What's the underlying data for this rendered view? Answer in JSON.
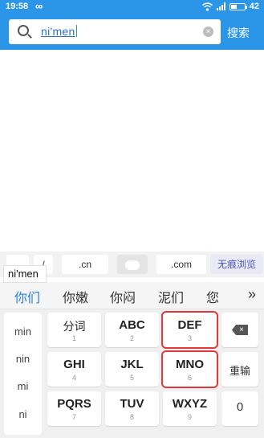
{
  "status_bar": {
    "time": "19:58",
    "battery": "42",
    "battery_level": 0.42
  },
  "search": {
    "query": "ni'men",
    "button_label": "搜索"
  },
  "quick_bar": {
    "slash": "/",
    "cn": ".cn",
    "com": ".com",
    "incognito": "无痕浏览"
  },
  "pinyin_composition": "ni'men",
  "candidates": [
    "你们",
    "你嫩",
    "你闷",
    "泥们",
    "您"
  ],
  "left_column": [
    "min",
    "nin",
    "mi",
    "ni"
  ],
  "keys": [
    {
      "main": "分词",
      "sub": "1"
    },
    {
      "main": "ABC",
      "sub": "2"
    },
    {
      "main": "DEF",
      "sub": "3"
    },
    {
      "main": "GHI",
      "sub": "4"
    },
    {
      "main": "JKL",
      "sub": "5"
    },
    {
      "main": "MNO",
      "sub": "6"
    },
    {
      "main": "PQRS",
      "sub": "7"
    },
    {
      "main": "TUV",
      "sub": "8"
    },
    {
      "main": "WXYZ",
      "sub": "9"
    }
  ],
  "side_keys": {
    "reset": "重输",
    "zero": "0"
  },
  "colors": {
    "header": "#2b96e8",
    "highlight_border": "#e03a3a",
    "first_candidate": "#2b7fd9"
  }
}
